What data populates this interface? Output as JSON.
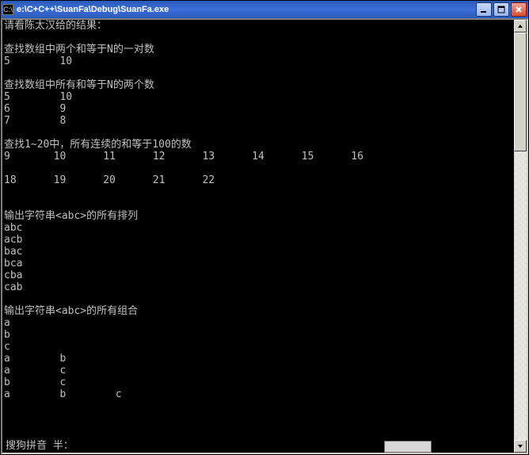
{
  "window": {
    "icon_label": "C:\\",
    "title_text": "e:\\C+C++\\SuanFa\\Debug\\SuanFa.exe"
  },
  "console_lines": [
    "请看陈太汉给的结果：",
    "",
    "查找数组中两个和等于N的一对数",
    "5        10",
    "",
    "查找数组中所有和等于N的两个数",
    "5        10",
    "6        9",
    "7        8",
    "",
    "查找1~20中，所有连续的和等于100的数",
    "9       10      11      12      13      14      15      16",
    "",
    "18      19      20      21      22",
    "",
    "",
    "输出字符串<abc>的所有排列",
    "abc",
    "acb",
    "bac",
    "bca",
    "cba",
    "cab",
    "",
    "输出字符串<abc>的所有组合",
    "a",
    "b",
    "c",
    "a        b",
    "a        c",
    "b        c",
    "a        b        c",
    ""
  ],
  "ime": {
    "label": "搜狗拼音  半："
  }
}
